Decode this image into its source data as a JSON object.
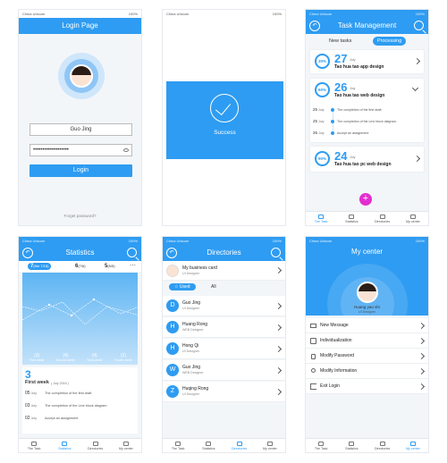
{
  "status": {
    "carrier": "China Unicom",
    "battery": "100%"
  },
  "login": {
    "title": "Login Page",
    "username": "Guo Jing",
    "password": "•••••••••••••••••••",
    "button": "Login",
    "forgot": "Forget password?"
  },
  "success": {
    "label": "Success"
  },
  "tasks": {
    "title": "Task Management",
    "tab_new": "New tasks",
    "tab_processing": "Processing",
    "items": [
      {
        "percent": "30%",
        "day": "27",
        "month": "July",
        "name": "Tao hua tao app design"
      },
      {
        "percent": "60%",
        "day": "26",
        "month": "July",
        "name": "Tao hua tao web design",
        "steps": [
          {
            "day": "25",
            "month": "July",
            "text": "The completion of the first draft."
          },
          {
            "day": "25",
            "month": "July",
            "text": "The completion of the Line block diagram."
          },
          {
            "day": "26",
            "month": "July",
            "text": "Accept an assignment"
          }
        ]
      },
      {
        "percent": "90%",
        "day": "24",
        "month": "July",
        "name": "Tao hua tao pc web design"
      }
    ]
  },
  "tabs_a": [
    "The Task",
    "Statistics",
    "Directories",
    "My center"
  ],
  "stats": {
    "title": "Statistics",
    "dates": [
      {
        "d": "7",
        "m": "(the 7/18)"
      },
      {
        "d": "6",
        "m": "(7/6)"
      },
      {
        "d": "5",
        "m": "(5/5)"
      }
    ],
    "weeks": [
      {
        "n": "(3)",
        "l": "First week"
      },
      {
        "n": "(4)",
        "l": "Second week"
      },
      {
        "n": "(4)",
        "l": "Third week"
      },
      {
        "n": "(2)",
        "l": "Fourth week"
      }
    ],
    "num": "3",
    "week_title": "First week",
    "week_sub": "( July 2016 )",
    "log": [
      {
        "d": "05",
        "m": "July",
        "t": "The completion of the first draft."
      },
      {
        "d": "03",
        "m": "July",
        "t": "The completion of the Line block diagram."
      },
      {
        "d": "02",
        "m": "July",
        "t": "Accept an assignment"
      }
    ]
  },
  "dirs": {
    "title": "Directories",
    "card": {
      "name": "My business card",
      "role": "UI Designer"
    },
    "seg_used": "Used",
    "seg_all": "All",
    "people": [
      {
        "l": "D",
        "n": "Guo Jing",
        "r": "UI Designer"
      },
      {
        "l": "H",
        "n": "Huang Rong",
        "r": "WEB Designer"
      },
      {
        "l": "H",
        "n": "Hong Qi",
        "r": "UI Designer"
      },
      {
        "l": "W",
        "n": "Guo Jing",
        "r": "WEB Designer"
      },
      {
        "l": "Z",
        "n": "Huqing Rong",
        "r": "UI Designer"
      }
    ]
  },
  "center": {
    "title": "My center",
    "name": "Huang yao shi",
    "role": "UI Designer",
    "menu": [
      "New Message",
      "Individualization",
      "Modify Password",
      "Modify Information",
      "Exit Login"
    ]
  },
  "colors": {
    "accent": "#2e9cf2",
    "fab": "#e42dd0"
  }
}
